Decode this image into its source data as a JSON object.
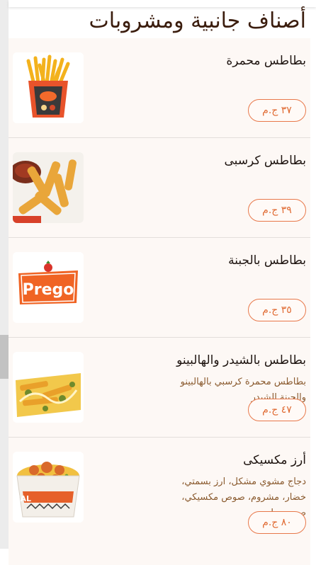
{
  "page": {
    "title": "أصناف جانبية ومشروبات"
  },
  "items": [
    {
      "name": "بطاطس محمرة",
      "desc": "",
      "price": "٣٧ ج.م",
      "image": "fries-box-image"
    },
    {
      "name": "بطاطس كرسبى",
      "desc": "",
      "price": "٣٩ ج.م",
      "image": "crispy-fries-image"
    },
    {
      "name": "بطاطس بالجبنة",
      "desc": "",
      "price": "٣٥ ج.م",
      "image": "prego-logo-image"
    },
    {
      "name": "بطاطس بالشيدر والهالبينو",
      "desc": "بطاطس محمرة كرسبي بالهالبينو والجبنة الشيدر",
      "price": "٤٧ ج.م",
      "image": "cheddar-jalapeno-fries-image"
    },
    {
      "name": "أرز مكسيكى",
      "desc": "دجاج مشوي مشكل، ارز بسمتي، خضار، مشروم، صوص مكسيكي، صوص حار",
      "price": "٨٠ ج.م",
      "image": "rice-meal-image"
    }
  ],
  "images": {
    "prego_logo_text": "Prego",
    "rice_meal_text": "Rice MEAL"
  },
  "colors": {
    "accent": "#e06a32",
    "title": "#3b1d0e",
    "card_bg": "#fdf8f5"
  }
}
